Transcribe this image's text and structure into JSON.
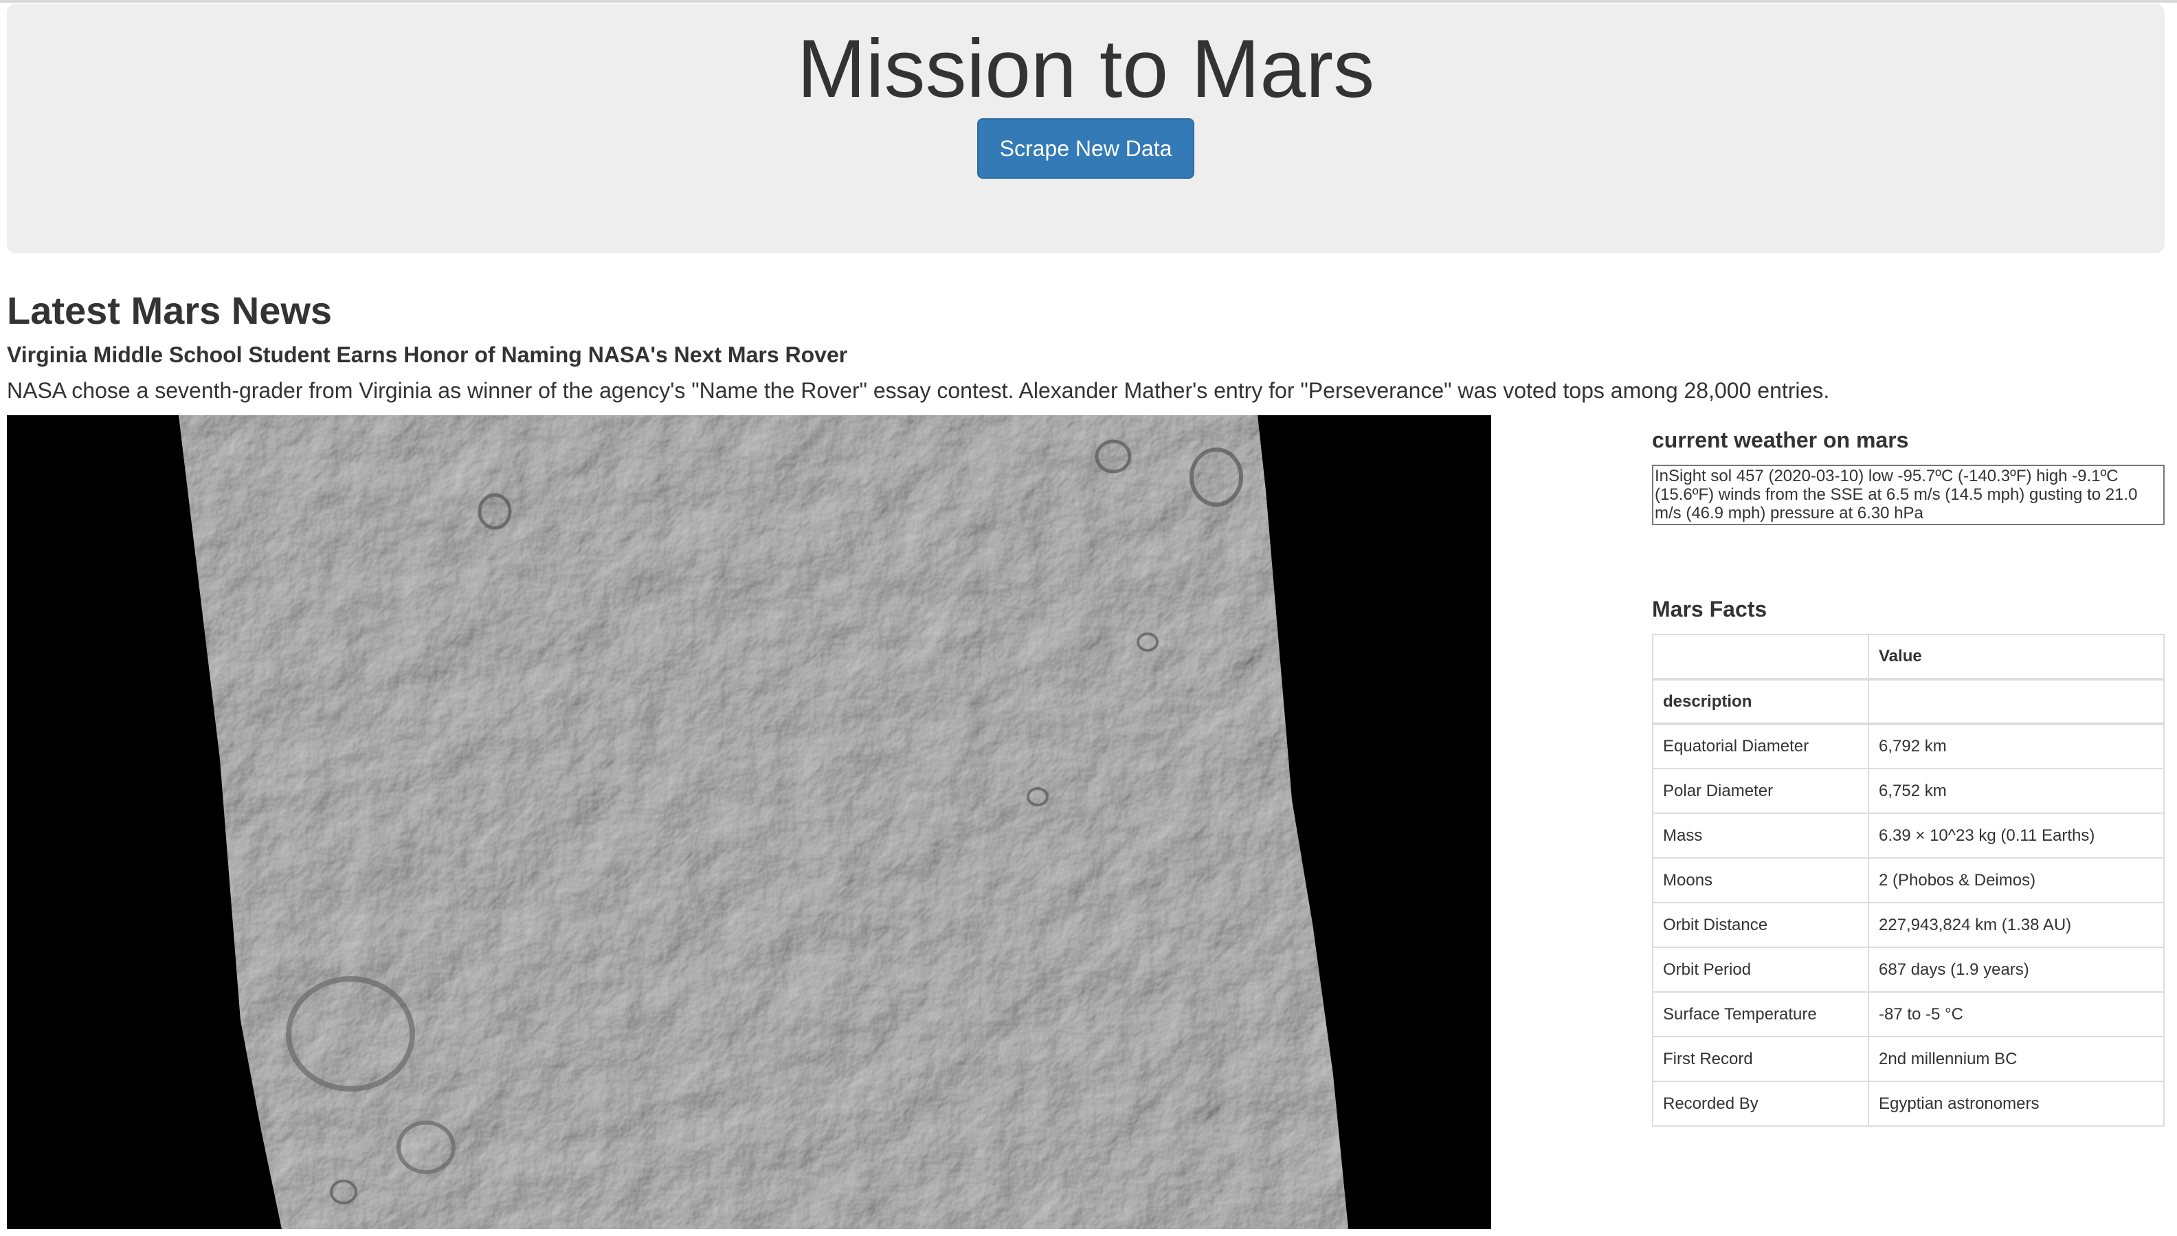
{
  "header": {
    "title": "Mission to Mars",
    "scrape_button_label": "Scrape New Data"
  },
  "news": {
    "section_heading": "Latest Mars News",
    "title": "Virginia Middle School Student Earns Honor of Naming NASA's Next Mars Rover",
    "teaser": "NASA chose a seventh-grader from Virginia as winner of the agency's \"Name the Rover\" essay contest. Alexander Mather's entry for \"Perseverance\" was voted tops among 28,000 entries."
  },
  "weather": {
    "heading": "current weather on mars",
    "text": "InSight sol 457 (2020-03-10) low -95.7ºC (-140.3ºF) high -9.1ºC (15.6ºF) winds from the SSE at 6.5 m/s (14.5 mph) gusting to 21.0 m/s (46.9 mph) pressure at 6.30 hPa"
  },
  "facts": {
    "heading": "Mars Facts",
    "header_blank": "",
    "header_value": "Value",
    "index_label": "description",
    "rows": [
      {
        "label": "Equatorial Diameter",
        "value": "6,792 km"
      },
      {
        "label": "Polar Diameter",
        "value": "6,752 km"
      },
      {
        "label": "Mass",
        "value": "6.39 × 10^23 kg (0.11 Earths)"
      },
      {
        "label": "Moons",
        "value": "2 (Phobos & Deimos)"
      },
      {
        "label": "Orbit Distance",
        "value": "227,943,824 km (1.38 AU)"
      },
      {
        "label": "Orbit Period",
        "value": "687 days (1.9 years)"
      },
      {
        "label": "Surface Temperature",
        "value": "-87 to -5 °C"
      },
      {
        "label": "First Record",
        "value": "2nd millennium BC"
      },
      {
        "label": "Recorded By",
        "value": "Egyptian astronomers"
      }
    ]
  },
  "colors": {
    "jumbotron_bg": "#eeeeee",
    "button_primary": "#337ab7",
    "text": "#333333"
  }
}
